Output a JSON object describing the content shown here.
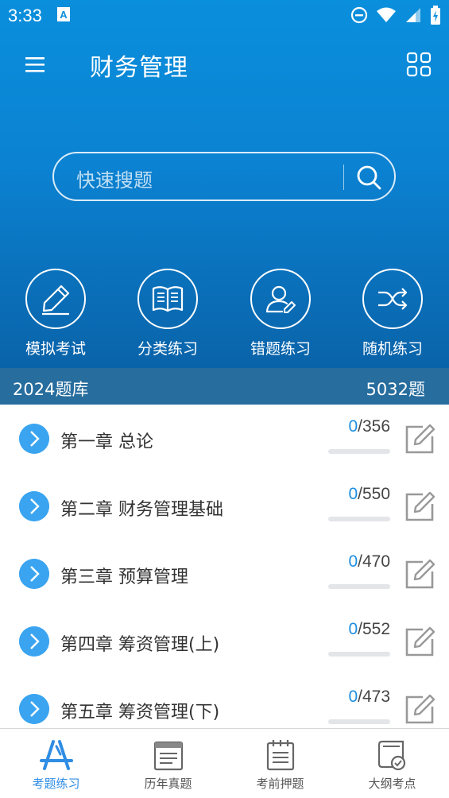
{
  "status_bar": {
    "time": "3:33"
  },
  "app_bar": {
    "title": "财务管理"
  },
  "search": {
    "placeholder": "快速搜题"
  },
  "quick_actions": [
    {
      "label": "模拟考试",
      "icon": "pencil-icon"
    },
    {
      "label": "分类练习",
      "icon": "book-icon"
    },
    {
      "label": "错题练习",
      "icon": "user-edit-icon"
    },
    {
      "label": "随机练习",
      "icon": "shuffle-icon"
    }
  ],
  "bank": {
    "name": "2024题库",
    "count": "5032题"
  },
  "chapters": [
    {
      "name": "第一章 总论",
      "done": "0",
      "total": "/356"
    },
    {
      "name": "第二章 财务管理基础",
      "done": "0",
      "total": "/550"
    },
    {
      "name": "第三章 预算管理",
      "done": "0",
      "total": "/470"
    },
    {
      "name": "第四章 筹资管理(上)",
      "done": "0",
      "total": "/552"
    },
    {
      "name": "第五章 筹资管理(下)",
      "done": "0",
      "total": "/473"
    }
  ],
  "tabs": [
    {
      "label": "考题练习",
      "active": true
    },
    {
      "label": "历年真题"
    },
    {
      "label": "考前押题"
    },
    {
      "label": "大纲考点"
    }
  ],
  "colors": {
    "accent": "#2f8de4",
    "header": "#0b82d2",
    "bank_bar": "#276d9e"
  }
}
